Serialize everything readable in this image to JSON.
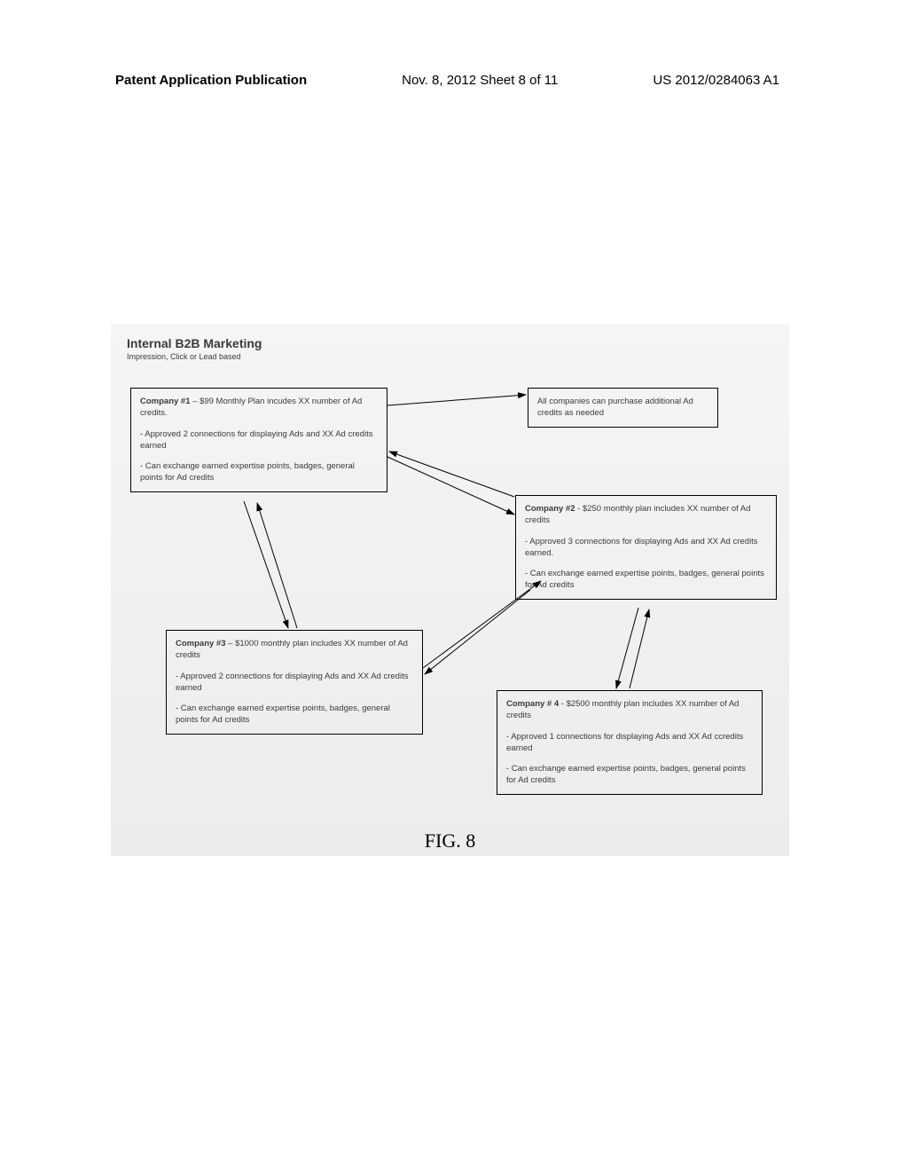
{
  "header": {
    "publication_type": "Patent Application Publication",
    "date_sheet": "Nov. 8, 2012   Sheet 8 of 11",
    "pub_number": "US 2012/0284063 A1"
  },
  "diagram": {
    "title": "Internal B2B Marketing",
    "subtitle": "Impression, Click or Lead based",
    "top_box": "All companies can purchase additional Ad credits as needed",
    "company1": {
      "label": "Company #1",
      "plan": " – $99 Monthly Plan incudes XX number of Ad credits.",
      "b1": "- Approved 2 connections for displaying Ads and XX Ad credits earned",
      "b2": "- Can exchange earned expertise points, badges, general points for Ad credits"
    },
    "company2": {
      "label": "Company #2",
      "plan": " - $250 monthly plan includes XX number of Ad credits",
      "b1": "- Approved 3 connections for displaying Ads and XX Ad credits earned.",
      "b2": "- Can exchange earned expertise points, badges, general points for Ad credits"
    },
    "company3": {
      "label": "Company #3",
      "plan": " – $1000 monthly plan includes XX number of Ad credits",
      "b1": "- Approved 2 connections for displaying Ads and XX Ad credits earned",
      "b2": "- Can exchange earned expertise points, badges, general points for Ad credits"
    },
    "company4": {
      "label": "Company # 4",
      "plan": " - $2500 monthly plan includes XX number of Ad credits",
      "b1": "- Approved 1 connections for displaying Ads and XX Ad ccredits earned",
      "b2": "- Can exchange earned expertise points, badges, general points for Ad credits"
    }
  },
  "figure_caption": "FIG. 8"
}
